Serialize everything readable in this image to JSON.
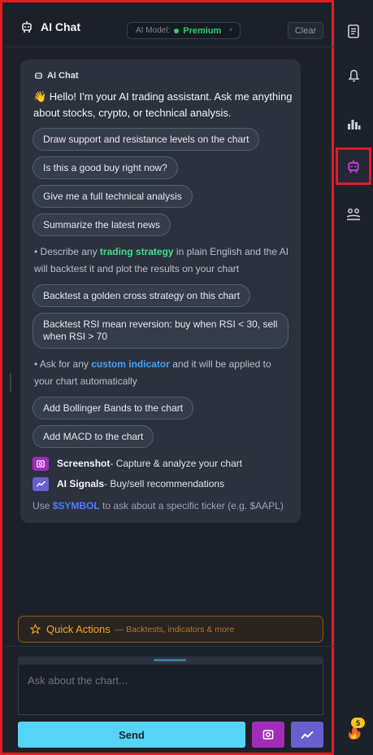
{
  "header": {
    "title": "AI Chat",
    "model_label": "AI Model:",
    "model_value": "Premium",
    "clear_label": "Clear"
  },
  "message": {
    "sender": "AI Chat",
    "greeting": "👋 Hello! I'm your AI trading assistant. Ask me anything about stocks, crypto, or technical analysis.",
    "suggestions": [
      "Draw support and resistance levels on the chart",
      "Is this a good buy right now?",
      "Give me a full technical analysis",
      "Summarize the latest news"
    ],
    "strategy_note": {
      "prefix": "• Describe any ",
      "highlight": "trading strategy",
      "suffix": " in plain English and the AI will backtest it and plot the results on your chart"
    },
    "strategy_suggestions": [
      "Backtest a golden cross strategy on this chart",
      "Backtest RSI mean reversion: buy when RSI < 30, sell when RSI > 70"
    ],
    "indicator_note": {
      "prefix": "• Ask for any ",
      "highlight": "custom indicator",
      "suffix": " and it will be applied to your chart automatically"
    },
    "indicator_suggestions": [
      "Add Bollinger Bands to the chart",
      "Add MACD to the chart"
    ],
    "features": [
      {
        "name": "Screenshot",
        "desc": " - Capture & analyze your chart",
        "icon": "camera-icon"
      },
      {
        "name": "AI Signals",
        "desc": " - Buy/sell recommendations",
        "icon": "trend-icon"
      }
    ],
    "hint": {
      "prefix": "Use ",
      "symbol": "$SYMBOL",
      "suffix": " to ask about a specific ticker (e.g. $AAPL)"
    }
  },
  "quick_actions": {
    "title": "Quick Actions",
    "subtitle": "— Backtests, indicators & more"
  },
  "composer": {
    "placeholder": "Ask about the chart...",
    "send_label": "Send"
  },
  "sidebar": {
    "icons": [
      "document-icon",
      "bell-icon",
      "bar-chart-icon",
      "robot-icon",
      "users-icon"
    ],
    "streak_count": "5"
  },
  "colors": {
    "highlight_border": "#e31b23",
    "accent_send": "#55d4f5",
    "premium_green": "#2ecc71",
    "strategy_green": "#3fe08a",
    "indicator_blue": "#3aa6ff",
    "quick_actions_orange": "#f5a623"
  }
}
